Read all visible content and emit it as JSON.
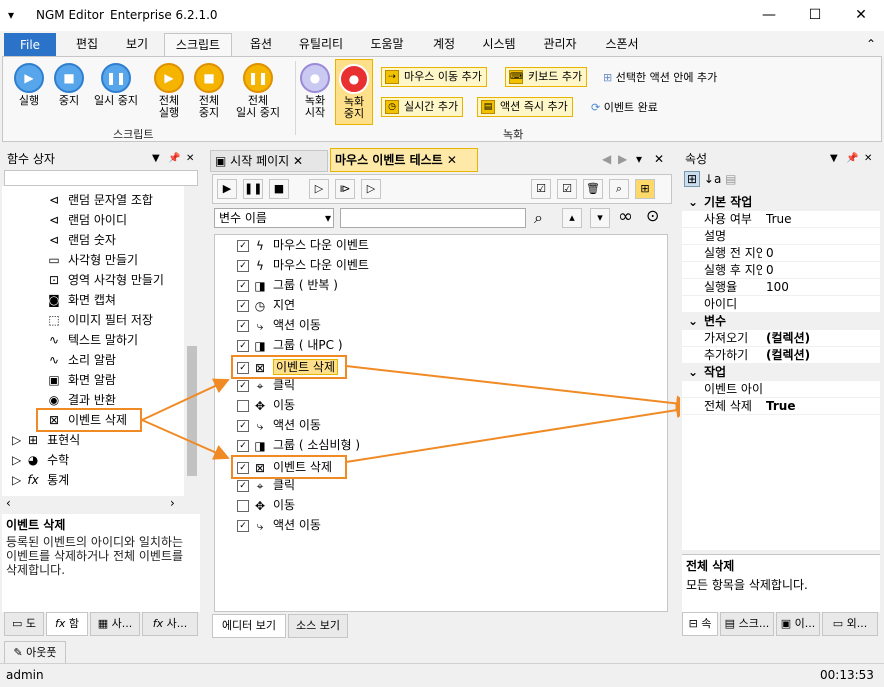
{
  "window": {
    "app": "NGM Editor",
    "edition": "Enterprise 6.2.1.0",
    "min": "—",
    "max": "☐",
    "close": "✕"
  },
  "menu": {
    "file": "File",
    "tabs": [
      "편집",
      "보기",
      "스크립트",
      "옵션",
      "유틸리티",
      "도움말",
      "계정",
      "시스템",
      "관리자",
      "스폰서"
    ]
  },
  "ribbon": {
    "script_group": "스크립트",
    "record_group": "녹화",
    "buttons": {
      "run": "실행",
      "stop": "중지",
      "pause": "일시 중지",
      "all_run_1": "전체",
      "all_run_2": "실행",
      "all_stop_1": "전체",
      "all_stop_2": "중지",
      "all_pause_1": "전체",
      "all_pause_2": "일시 중지",
      "rec_start_1": "녹화",
      "rec_start_2": "시작",
      "rec_stop_1": "녹화",
      "rec_stop_2": "중지"
    },
    "small": {
      "mouse_move": "마우스 이동 추가",
      "keyboard": "키보드 추가",
      "in_selected": "선택한 액션 안에 추가",
      "realtime": "실시간 추가",
      "action_now": "액션 즉시 추가",
      "event_done": "이벤트 완료"
    }
  },
  "left_panel": {
    "title": "함수 상자",
    "items": [
      "랜덤 문자열 조합",
      "랜덤 아이디",
      "랜덤 숫자",
      "사각형 만들기",
      "영역 사각형 만들기",
      "화면 캡쳐",
      "이미지 필터 저장",
      "텍스트 말하기",
      "소리 알람",
      "화면 알람",
      "결과 반환",
      "이벤트 삭제"
    ],
    "groups": [
      "표현식",
      "수학",
      "통계"
    ],
    "desc_title": "이벤트 삭제",
    "desc_text": "등록된 이벤트의 아이디와 일치하는 이벤트를 삭제하거나 전체 이벤트를 삭제합니다.",
    "tabs": [
      "도",
      "함",
      "사...",
      "사..."
    ]
  },
  "doc": {
    "tabs": [
      "시작 페이지",
      "마우스 이벤트 테스트"
    ],
    "var_select": "변수 이름",
    "rows": [
      "마우스 다운 이벤트",
      "마우스 다운 이벤트",
      "그룹 ( 반복 )",
      "지연",
      "액션 이동",
      "그룹 ( 내PC )",
      "이벤트 삭제",
      "클릭",
      "이동",
      "액션 이동",
      "그룹 ( 소심비형 )",
      "이벤트 삭제",
      "클릭",
      "이동",
      "액션 이동"
    ],
    "bottom_tabs": [
      "에디터 보기",
      "소스 보기"
    ]
  },
  "props": {
    "title": "속성",
    "cat_basic": "기본 작업",
    "basic": [
      [
        "사용 여부",
        "True"
      ],
      [
        "설명",
        ""
      ],
      [
        "실행 전 지연",
        "0"
      ],
      [
        "실행 후 지연",
        "0"
      ],
      [
        "실행율",
        "100"
      ],
      [
        "아이디",
        ""
      ]
    ],
    "cat_var": "변수",
    "var": [
      [
        "가져오기",
        "(컬렉션)"
      ],
      [
        "추가하기",
        "(컬렉션)"
      ]
    ],
    "cat_work": "작업",
    "work": [
      [
        "이벤트 아이디",
        ""
      ],
      [
        "전체 삭제",
        "True"
      ]
    ],
    "desc_title": "전체 삭제",
    "desc_text": "모든 항목을 삭제합니다.",
    "tabs": [
      "속",
      "스크...",
      "이...",
      "외..."
    ]
  },
  "outline_tab": "아웃풋",
  "status": {
    "user": "admin",
    "time": "00:13:53"
  }
}
